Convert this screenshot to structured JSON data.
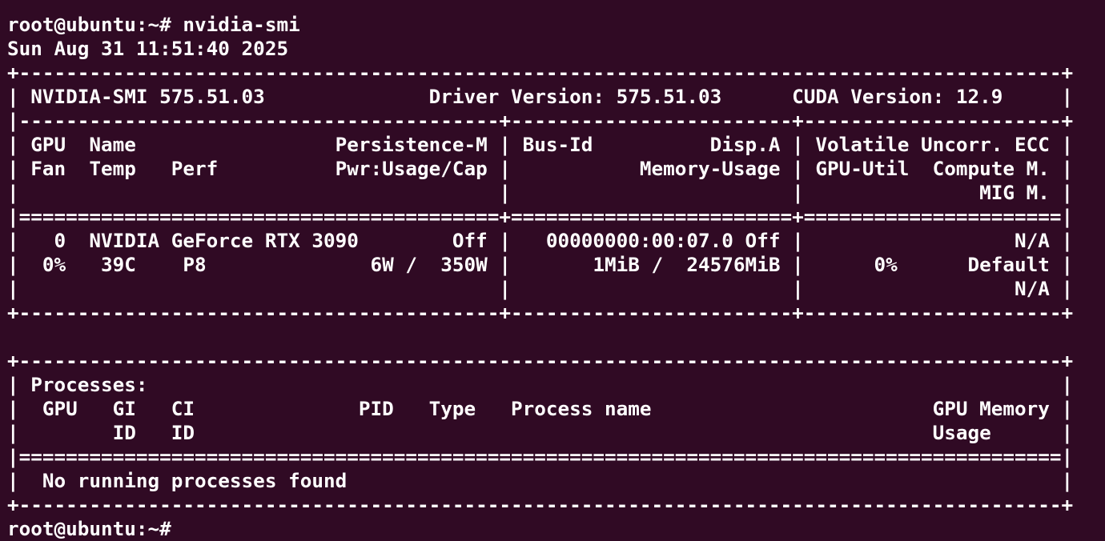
{
  "terminal": {
    "lines": [
      "root@ubuntu:~# nvidia-smi",
      "Sun Aug 31 11:51:40 2025",
      "+-----------------------------------------------------------------------------------------+",
      "| NVIDIA-SMI 575.51.03              Driver Version: 575.51.03      CUDA Version: 12.9     |",
      "|-----------------------------------------+------------------------+----------------------+",
      "| GPU  Name                 Persistence-M | Bus-Id          Disp.A | Volatile Uncorr. ECC |",
      "| Fan  Temp   Perf          Pwr:Usage/Cap |           Memory-Usage | GPU-Util  Compute M. |",
      "|                                         |                        |               MIG M. |",
      "|=========================================+========================+======================|",
      "|   0  NVIDIA GeForce RTX 3090        Off |   00000000:00:07.0 Off |                  N/A |",
      "|  0%   39C    P8              6W /  350W |       1MiB /  24576MiB |      0%      Default |",
      "|                                         |                        |                  N/A |",
      "+-----------------------------------------+------------------------+----------------------+",
      "",
      "+-----------------------------------------------------------------------------------------+",
      "| Processes:                                                                              |",
      "|  GPU   GI   CI              PID   Type   Process name                        GPU Memory |",
      "|        ID   ID                                                               Usage      |",
      "|=========================================================================================|",
      "|  No running processes found                                                             |",
      "+-----------------------------------------------------------------------------------------+",
      "root@ubuntu:~#"
    ]
  }
}
